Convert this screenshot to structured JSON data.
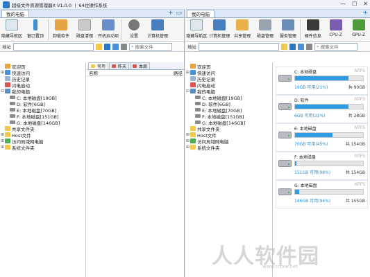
{
  "app": {
    "title": "超级文件资源管理器X V1.0.0 丨 64位操作系统"
  },
  "left": {
    "tab": "我的电脑",
    "ribbon": [
      "隐藏导航区",
      "窗口置顶",
      "卸载软件",
      "磁盘清理",
      "开机启动项",
      "设置",
      "计算机管理"
    ],
    "address_label": "地址",
    "address_value": "",
    "search_placeholder": "搜索文件",
    "file_tabs": [
      "常用",
      "昨天",
      "本周"
    ],
    "columns": {
      "name": "名称",
      "path": "路径"
    },
    "tree": [
      "欢迎页",
      "快速访问",
      "历史记录",
      "闪电启动",
      "我的电脑",
      "C: 本地磁盘[19GB]",
      "D: 软件[6GB]",
      "E: 本地磁盘[70GB]",
      "F: 本地磁盘[151GB]",
      "G: 本地磁盘[146GB]",
      "共享文件夹",
      "Host文件",
      "访问局域网电脑",
      "系统文件夹"
    ]
  },
  "right": {
    "tab": "我的电脑",
    "ribbon": [
      "隐藏导航区",
      "计算机管理",
      "共享管理",
      "磁盘管理",
      "服务管理",
      "硬件信息",
      "CPU-Z",
      "GPU-Z"
    ],
    "address_label": "地址",
    "address_value": "",
    "search_placeholder": "搜索文件",
    "tree": [
      "欢迎页",
      "快速访问",
      "历史记录",
      "闪电启动",
      "我的电脑",
      "C: 本地磁盘[19GB]",
      "D: 软件[6GB]",
      "E: 本地磁盘[70GB]",
      "F: 本地磁盘[151GB]",
      "G: 本地磁盘[146GB]",
      "共享文件夹",
      "Host文件",
      "访问局域网电脑",
      "系统文件夹"
    ],
    "drives": [
      {
        "name": "C: 本地磁盘",
        "fs": "NTFS",
        "free": "19GB 可用(21%)",
        "total": "共 90GB",
        "used_fraction": 0.79
      },
      {
        "name": "D: 软件",
        "fs": "NTFS",
        "free": "6GB 可用(21%)",
        "total": "共 28GB",
        "used_fraction": 0.79
      },
      {
        "name": "E: 本地磁盘",
        "fs": "NTFS",
        "free": "70GB 可用(45%)",
        "total": "共 154GB",
        "used_fraction": 0.55
      },
      {
        "name": "F: 本地磁盘",
        "fs": "NTFS",
        "free": "151GB 可用(98%)",
        "total": "共 154GB",
        "used_fraction": 0.02
      },
      {
        "name": "G: 本地磁盘",
        "fs": "NTFS",
        "free": "146GB 可用(94%)",
        "total": "共 155GB",
        "used_fraction": 0.06
      }
    ]
  },
  "watermark": {
    "text": "人人软件园",
    "url": "www.rrzxw.net"
  }
}
